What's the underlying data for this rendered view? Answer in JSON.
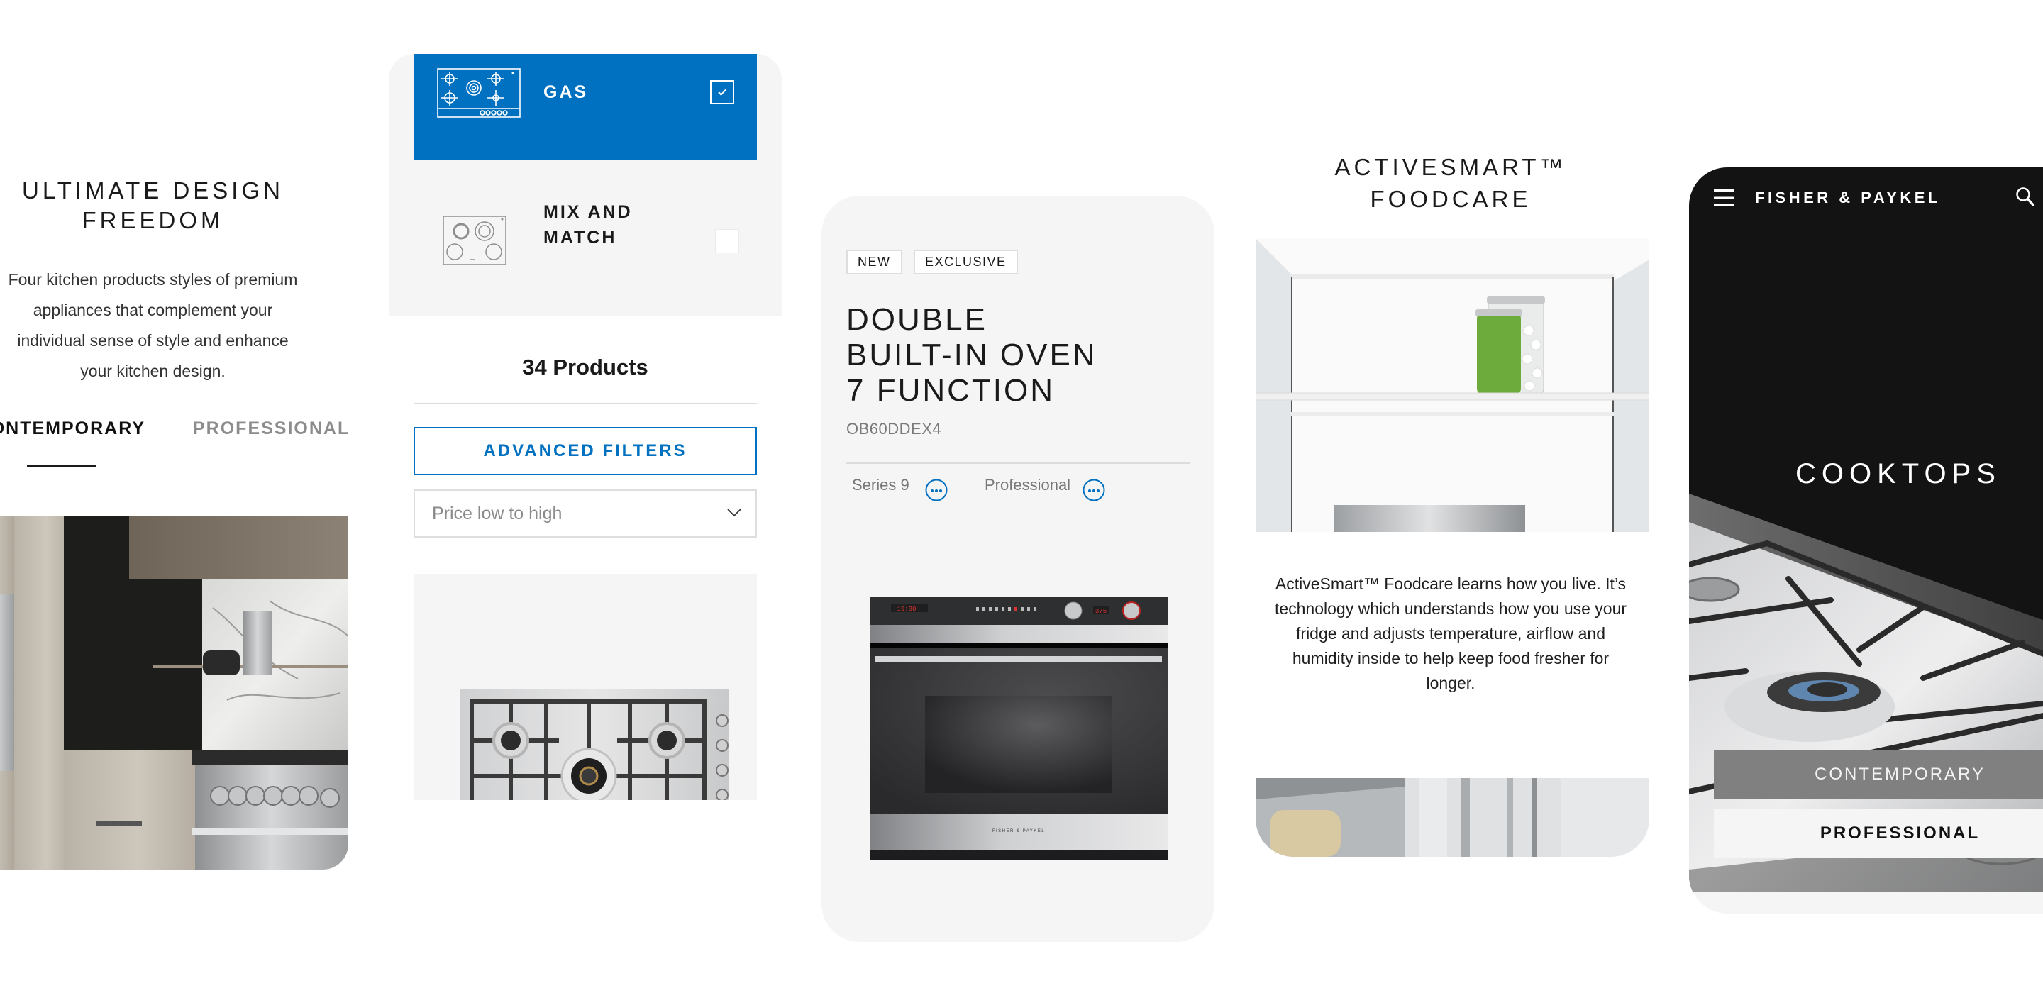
{
  "design_freedom": {
    "title_lines": [
      "ULTIMATE DESIGN",
      "FREEDOM"
    ],
    "description": "Four kitchen products styles of premium appliances that complement your individual sense of style and enhance your kitchen design.",
    "tabs": [
      {
        "label": "CONTEMPORARY",
        "active": true
      },
      {
        "label": "PROFESSIONAL",
        "active": false
      }
    ],
    "image_alt": "kitchen-interior-photo"
  },
  "cooktop_filter": {
    "options": [
      {
        "label": "GAS",
        "checked": true,
        "icon": "gas-cooktop-icon"
      },
      {
        "label_lines": [
          "MIX AND",
          "MATCH"
        ],
        "checked": false,
        "icon": "mix-match-cooktop-icon"
      }
    ],
    "product_count": "34 Products",
    "advanced_filters_label": "ADVANCED FILTERS",
    "sort": {
      "value": "Price low to high"
    },
    "accent_color": "#0070c0"
  },
  "product_card": {
    "badges": [
      "NEW",
      "EXCLUSIVE"
    ],
    "title_lines": [
      "DOUBLE",
      "BUILT-IN OVEN",
      "7 FUNCTION"
    ],
    "sku": "OB60DDEX4",
    "series": "Series 9",
    "style": "Professional",
    "oven_display_time": "19:30",
    "oven_display_temp": "375",
    "oven_brand": "FISHER & PAYKEL"
  },
  "activesmart": {
    "title_lines": [
      "ACTIVESMART™",
      "FOODCARE"
    ],
    "description": "ActiveSmart™ Foodcare learns how you live. It’s technology which understands how you use your fridge and adjusts temperature, airflow and humidity inside to help keep food fresher for longer."
  },
  "cooktops_mobile": {
    "brand": "FISHER & PAYKEL",
    "heading": "COOKTOPS",
    "buttons": [
      {
        "label": "CONTEMPORARY",
        "selected": false
      },
      {
        "label": "PROFESSIONAL",
        "selected": true
      }
    ]
  }
}
